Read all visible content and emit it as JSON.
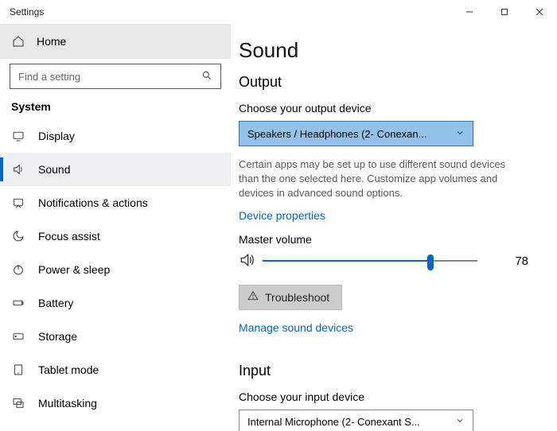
{
  "window": {
    "title": "Settings"
  },
  "sidebar": {
    "home": "Home",
    "search_placeholder": "Find a setting",
    "section": "System",
    "items": [
      {
        "label": "Display"
      },
      {
        "label": "Sound"
      },
      {
        "label": "Notifications & actions"
      },
      {
        "label": "Focus assist"
      },
      {
        "label": "Power & sleep"
      },
      {
        "label": "Battery"
      },
      {
        "label": "Storage"
      },
      {
        "label": "Tablet mode"
      },
      {
        "label": "Multitasking"
      }
    ]
  },
  "main": {
    "title": "Sound",
    "output": {
      "heading": "Output",
      "choose_label": "Choose your output device",
      "device": "Speakers / Headphones (2- Conexan...",
      "desc": "Certain apps may be set up to use different sound devices than the one selected here. Customize app volumes and devices in advanced sound options.",
      "device_props": "Device properties",
      "master_label": "Master volume",
      "volume": 78,
      "troubleshoot": "Troubleshoot",
      "manage": "Manage sound devices"
    },
    "input": {
      "heading": "Input",
      "choose_label": "Choose your input device",
      "device": "Internal Microphone (2- Conexant S..."
    }
  }
}
